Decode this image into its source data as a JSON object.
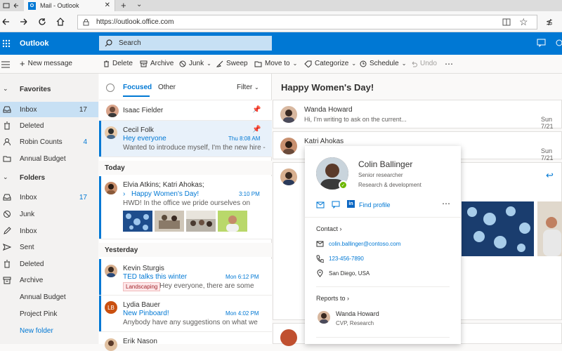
{
  "browser": {
    "tab_title": "Mail - Outlook",
    "url": "https://outlook.office.com"
  },
  "header": {
    "app_name": "Outlook",
    "search_placeholder": "Search"
  },
  "toolbar": {
    "new_message": "New message",
    "delete": "Delete",
    "archive": "Archive",
    "junk": "Junk",
    "sweep": "Sweep",
    "move_to": "Move to",
    "categorize": "Categorize",
    "schedule": "Schedule",
    "undo": "Undo"
  },
  "nav": {
    "favorites_label": "Favorites",
    "favorites": [
      {
        "label": "Inbox",
        "count": "17"
      },
      {
        "label": "Deleted",
        "count": ""
      },
      {
        "label": "Robin Counts",
        "count": "4"
      },
      {
        "label": "Annual Budget",
        "count": ""
      }
    ],
    "folders_label": "Folders",
    "folders": [
      {
        "label": "Inbox",
        "count": "17"
      },
      {
        "label": "Junk",
        "count": ""
      },
      {
        "label": "Inbox",
        "count": ""
      },
      {
        "label": "Sent",
        "count": ""
      },
      {
        "label": "Deleted",
        "count": ""
      },
      {
        "label": "Archive",
        "count": ""
      },
      {
        "label": "Annual Budget",
        "count": ""
      },
      {
        "label": "Project Pink",
        "count": ""
      }
    ],
    "new_folder": "New folder"
  },
  "list": {
    "tab_focused": "Focused",
    "tab_other": "Other",
    "filter": "Filter",
    "pinned_sender": "Isaac Fielder",
    "selected": {
      "sender": "Cecil Folk",
      "subject": "Hey everyone",
      "time": "Thu 8:08 AM",
      "preview": "Wanted to introduce myself, I'm the new hire -"
    },
    "today_label": "Today",
    "today": {
      "sender": "Elvia Atkins; Katri Ahokas;",
      "subject": "Happy Women's Day!",
      "time": "3:10 PM",
      "preview": "HWD! In the office we pride ourselves on"
    },
    "yesterday_label": "Yesterday",
    "kevin": {
      "sender": "Kevin Sturgis",
      "subject": "TED talks this winter",
      "time": "Mon 6:12 PM",
      "tag": "Landscaping",
      "preview": "Hey everyone, there are some"
    },
    "lydia": {
      "initials": "LB",
      "sender": "Lydia Bauer",
      "subject": "New Pinboard!",
      "time": "Mon 4:02 PM",
      "preview": "Anybody have any suggestions on what we"
    },
    "erik": {
      "sender": "Erik Nason"
    }
  },
  "reading": {
    "subject": "Happy Women's Day!",
    "msg1": {
      "sender": "Wanda Howard",
      "preview": "Hi, I'm writing to ask on the current...",
      "time": "Sun 7/21"
    },
    "msg2": {
      "sender": "Katri Ahokas",
      "time": "Sun 7/21"
    }
  },
  "contact": {
    "name": "Colin Ballinger",
    "title": "Senior researcher",
    "dept": "Research & development",
    "find_profile": "Find profile",
    "contact_label": "Contact",
    "email": "colin.ballinger@contoso.com",
    "phone": "123-456-7890",
    "location": "San Diego, USA",
    "reports_label": "Reports to",
    "manager_name": "Wanda Howard",
    "manager_title": "CVP, Research"
  },
  "colors": {
    "brand": "#0078d4",
    "search_bg": "#c7e0f4",
    "tag_bg": "#fde7e9",
    "presence": "#6bb700"
  }
}
